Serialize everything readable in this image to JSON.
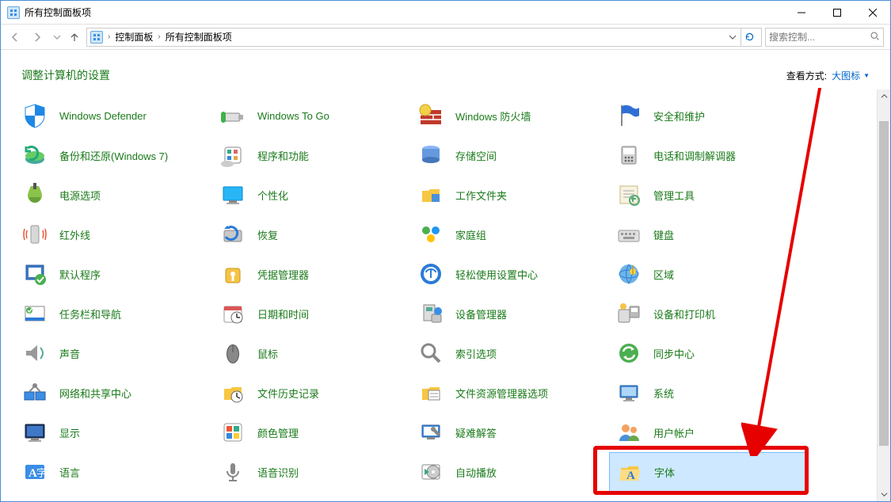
{
  "window": {
    "title": "所有控制面板项"
  },
  "breadcrumb": {
    "seg1": "控制面板",
    "seg2": "所有控制面板项"
  },
  "search": {
    "placeholder": "搜索控制..."
  },
  "header": {
    "adjust": "调整计算机的设置",
    "viewby_label": "查看方式:",
    "viewby_value": "大图标"
  },
  "items": [
    [
      {
        "label": "Windows Defender",
        "icon": "shield-defender"
      },
      {
        "label": "Windows To Go",
        "icon": "usb"
      },
      {
        "label": "Windows 防火墙",
        "icon": "firewall"
      },
      {
        "label": "安全和维护",
        "icon": "flag"
      }
    ],
    [
      {
        "label": "备份和还原(Windows 7)",
        "icon": "backup"
      },
      {
        "label": "程序和功能",
        "icon": "programs"
      },
      {
        "label": "存储空间",
        "icon": "storage"
      },
      {
        "label": "电话和调制解调器",
        "icon": "phone"
      }
    ],
    [
      {
        "label": "电源选项",
        "icon": "power"
      },
      {
        "label": "个性化",
        "icon": "personalize"
      },
      {
        "label": "工作文件夹",
        "icon": "workfolders"
      },
      {
        "label": "管理工具",
        "icon": "admintools"
      }
    ],
    [
      {
        "label": "红外线",
        "icon": "infrared"
      },
      {
        "label": "恢复",
        "icon": "recovery"
      },
      {
        "label": "家庭组",
        "icon": "homegroup"
      },
      {
        "label": "键盘",
        "icon": "keyboard"
      }
    ],
    [
      {
        "label": "默认程序",
        "icon": "defaultprogs"
      },
      {
        "label": "凭据管理器",
        "icon": "credentials"
      },
      {
        "label": "轻松使用设置中心",
        "icon": "easeofaccess"
      },
      {
        "label": "区域",
        "icon": "region"
      }
    ],
    [
      {
        "label": "任务栏和导航",
        "icon": "taskbar"
      },
      {
        "label": "日期和时间",
        "icon": "datetime"
      },
      {
        "label": "设备管理器",
        "icon": "devicemgr"
      },
      {
        "label": "设备和打印机",
        "icon": "devices"
      }
    ],
    [
      {
        "label": "声音",
        "icon": "sound"
      },
      {
        "label": "鼠标",
        "icon": "mouse"
      },
      {
        "label": "索引选项",
        "icon": "indexing"
      },
      {
        "label": "同步中心",
        "icon": "sync"
      }
    ],
    [
      {
        "label": "网络和共享中心",
        "icon": "network"
      },
      {
        "label": "文件历史记录",
        "icon": "filehistory"
      },
      {
        "label": "文件资源管理器选项",
        "icon": "folderoptions"
      },
      {
        "label": "系统",
        "icon": "system"
      }
    ],
    [
      {
        "label": "显示",
        "icon": "display"
      },
      {
        "label": "颜色管理",
        "icon": "color"
      },
      {
        "label": "疑难解答",
        "icon": "troubleshoot"
      },
      {
        "label": "用户帐户",
        "icon": "users"
      }
    ],
    [
      {
        "label": "语言",
        "icon": "language"
      },
      {
        "label": "语音识别",
        "icon": "speech"
      },
      {
        "label": "自动播放",
        "icon": "autoplay"
      },
      {
        "label": "字体",
        "icon": "fonts",
        "selected": true
      }
    ]
  ]
}
